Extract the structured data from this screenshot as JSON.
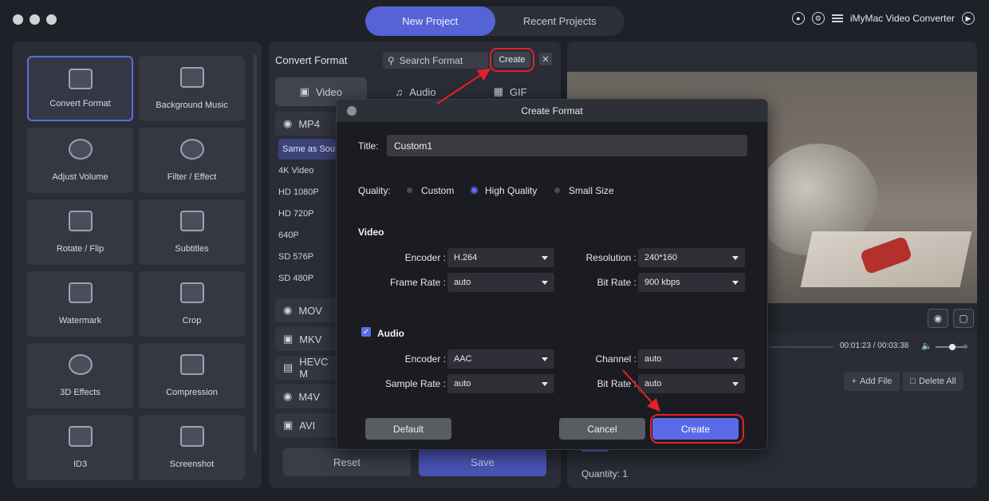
{
  "app": {
    "name": "iMyMac Video Converter",
    "tabs": [
      {
        "label": "New Project",
        "active": true
      },
      {
        "label": "Recent Projects",
        "active": false
      }
    ]
  },
  "tools": [
    {
      "label": "Convert Format",
      "icon": "convert-format-icon",
      "selected": true
    },
    {
      "label": "Background Music",
      "icon": "music-icon",
      "selected": false
    },
    {
      "label": "Adjust Volume",
      "icon": "volume-bell-icon",
      "selected": false
    },
    {
      "label": "Filter / Effect",
      "icon": "filter-icon",
      "selected": false
    },
    {
      "label": "Rotate / Flip",
      "icon": "rotate-icon",
      "selected": false
    },
    {
      "label": "Subtitles",
      "icon": "subtitles-icon",
      "selected": false
    },
    {
      "label": "Watermark",
      "icon": "watermark-icon",
      "selected": false
    },
    {
      "label": "Crop",
      "icon": "crop-icon",
      "selected": false
    },
    {
      "label": "3D Effects",
      "icon": "3d-glasses-icon",
      "selected": false
    },
    {
      "label": "Compression",
      "icon": "compression-icon",
      "selected": false
    },
    {
      "label": "ID3",
      "icon": "id3-icon",
      "selected": false
    },
    {
      "label": "Screenshot",
      "icon": "screenshot-icon",
      "selected": false
    }
  ],
  "convert_panel": {
    "title": "Convert Format",
    "search_placeholder": "Search Format",
    "create_label": "Create",
    "close_label": "✕",
    "tabs": [
      {
        "label": "Video",
        "active": true
      },
      {
        "label": "Audio",
        "active": false
      },
      {
        "label": "GIF",
        "active": false
      }
    ],
    "categories": [
      "MP4",
      "MOV",
      "MKV",
      "HEVC M",
      "M4V",
      "AVI"
    ],
    "mp4_presets": [
      "Same as Sou",
      "4K Video",
      "HD 1080P",
      "HD 720P",
      "640P",
      "SD 576P",
      "SD 480P"
    ],
    "reset_label": "Reset",
    "save_label": "Save"
  },
  "player": {
    "timecode": "00:01:23 / 00:03:38",
    "add_file_label": "Add File",
    "delete_all_label": "Delete All",
    "quantity_label": "Quantity: 1"
  },
  "dialog": {
    "title": "Create Format",
    "title_label": "Title:",
    "title_value": "Custom1",
    "quality_label": "Quality:",
    "quality_options": [
      {
        "label": "Custom",
        "selected": false
      },
      {
        "label": "High Quality",
        "selected": true
      },
      {
        "label": "Small Size",
        "selected": false
      }
    ],
    "video_section": "Video",
    "video": {
      "encoder_label": "Encoder :",
      "encoder_value": "H.264",
      "resolution_label": "Resolution :",
      "resolution_value": "240*160",
      "frame_rate_label": "Frame Rate :",
      "frame_rate_value": "auto",
      "bit_rate_label": "Bit Rate :",
      "bit_rate_value": "900 kbps"
    },
    "audio_section": "Audio",
    "audio_enabled": true,
    "audio": {
      "encoder_label": "Encoder :",
      "encoder_value": "AAC",
      "channel_label": "Channel :",
      "channel_value": "auto",
      "sample_rate_label": "Sample Rate :",
      "sample_rate_value": "auto",
      "bit_rate_label": "Bit Rate :",
      "bit_rate_value": "auto"
    },
    "default_label": "Default",
    "cancel_label": "Cancel",
    "create_label": "Create"
  },
  "colors": {
    "accent": "#5b6be8",
    "highlight_ring": "#e5202a",
    "background": "#1f2129"
  }
}
